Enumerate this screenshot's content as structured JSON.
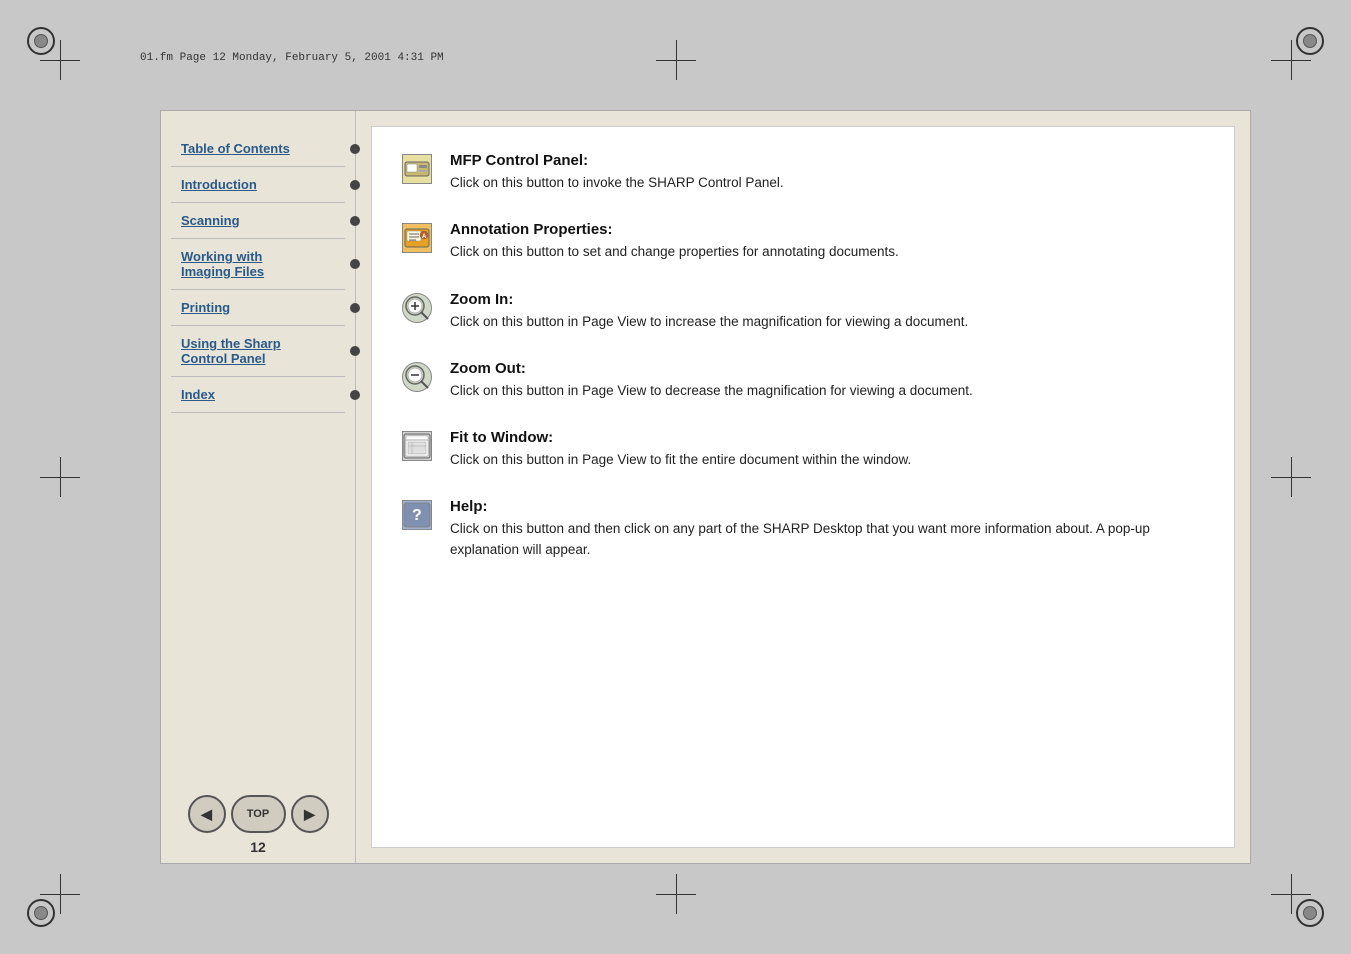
{
  "page": {
    "filename": "01.fm  Page 12  Monday, February 5, 2001  4:31 PM",
    "page_number": "12"
  },
  "sidebar": {
    "nav_items": [
      {
        "id": "table-of-contents",
        "label": "Table of Contents",
        "active": false
      },
      {
        "id": "introduction",
        "label": "Introduction",
        "active": false
      },
      {
        "id": "scanning",
        "label": "Scanning",
        "active": false
      },
      {
        "id": "working-with-imaging-files",
        "label": "Working with\nImaging Files",
        "active": false
      },
      {
        "id": "printing",
        "label": "Printing",
        "active": false
      },
      {
        "id": "using-sharp-control-panel",
        "label": "Using the Sharp\nControl Panel",
        "active": false
      },
      {
        "id": "index",
        "label": "Index",
        "active": false
      }
    ],
    "buttons": {
      "back": "◀",
      "top": "TOP",
      "forward": "▶"
    }
  },
  "content": {
    "items": [
      {
        "id": "mfp-control-panel",
        "icon_type": "mfp",
        "title": "MFP Control Panel:",
        "description": "Click on this button to invoke the SHARP Control Panel."
      },
      {
        "id": "annotation-properties",
        "icon_type": "annotation",
        "title": "Annotation Properties:",
        "description": "Click on this button to set and change properties for annotating documents."
      },
      {
        "id": "zoom-in",
        "icon_type": "zoom-in",
        "title": "Zoom In:",
        "description": "Click on this button in Page View to increase the magnification for viewing a document."
      },
      {
        "id": "zoom-out",
        "icon_type": "zoom-out",
        "title": "Zoom Out:",
        "description": "Click on this button in Page View to decrease the magnification for viewing a document."
      },
      {
        "id": "fit-to-window",
        "icon_type": "fit",
        "title": "Fit to Window:",
        "description": "Click on this button in Page View to fit the entire document within the window."
      },
      {
        "id": "help",
        "icon_type": "help",
        "title": "Help:",
        "description": "Click on this button and then click on any part of the SHARP Desktop that you want more information about. A pop-up explanation will appear."
      }
    ]
  }
}
